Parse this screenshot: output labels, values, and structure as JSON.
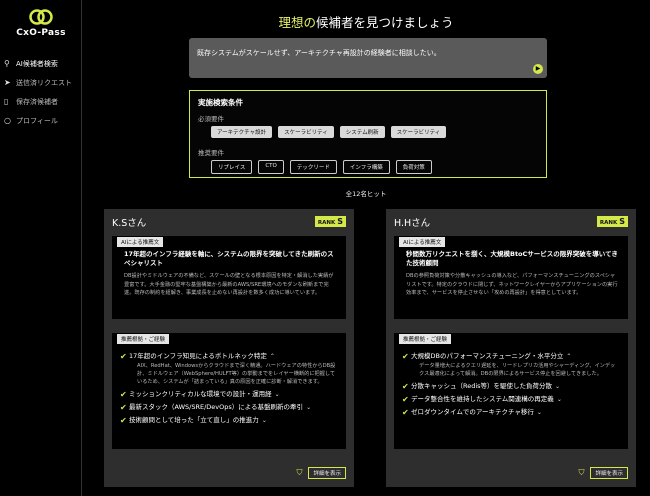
{
  "app": {
    "name": "CxO-Pass"
  },
  "sidebar": {
    "items": [
      {
        "label": "AI候補者検索",
        "icon": "search-person-icon",
        "active": true
      },
      {
        "label": "送信済リクエスト",
        "icon": "send-icon",
        "active": false
      },
      {
        "label": "保存済候補者",
        "icon": "bookmark-icon",
        "active": false
      },
      {
        "label": "プロフィール",
        "icon": "person-icon",
        "active": false
      }
    ]
  },
  "main": {
    "title_pre": "理想の",
    "title_post": "候補者を見つけましょう",
    "query": "既存システムがスケールせず、アーキテクチャ再設計の経験者に相談したい。",
    "conditions": {
      "title": "実施検索条件",
      "required_label": "必須要件",
      "required": [
        "アーキテクチャ設計",
        "スケーラビリティ",
        "システム刷新",
        "スケーラビリティ"
      ],
      "preferred_label": "推奨要件",
      "preferred": [
        "リプレイス",
        "CTO",
        "テックリード",
        "インフラ構築",
        "負荷対策"
      ]
    },
    "hits": "全12名ヒット"
  },
  "cards": [
    {
      "name": "K.Sさん",
      "rank_label": "RANK",
      "rank": "S",
      "ai_label": "AIによる推薦文",
      "ai_head": "17年超のインフラ経験を軸に、システムの限界を突破してきた刷新のスペシャリスト",
      "ai_body": "DB設計やミドルウェアの不備など、スケールの壁となる根本原因を特定・解消した実績が豊富です。大手金融の堅牢な基盤構築から最新のAWS/SRE環境へのモダンな刷新まで完遂。既存の制約を紐解き、事業成長を止めない再設計を数多く成功に導いています。",
      "rs_label": "推薦根拠・ご経験",
      "points": [
        {
          "text": "17年超のインフラ知見によるボトルネック特定",
          "detail": "AIX、RedHat、Windowsからクラウドまで深く精通。ハードウェアの特性からDB設計、ミドルウェア（WebSphere/HULFT等）の挙動までをレイヤー横断的に把握しているため、システムが「詰まっている」真の原因を正確に診断・解消できます。"
        },
        {
          "text": "ミッションクリティカルな環境での設計・運用経",
          "detail": ""
        },
        {
          "text": "最新スタック（AWS/SRE/DevOps）による基盤刷新の牽引",
          "detail": ""
        },
        {
          "text": "技術顧問として培った「立て直し」の推進力",
          "detail": ""
        }
      ],
      "detail_button": "詳細を表示"
    },
    {
      "name": "H.Hさん",
      "rank_label": "RANK",
      "rank": "S",
      "ai_label": "AIによる推薦文",
      "ai_head": "秒間数万リクエストを捌く、大規模BtoCサービスの限界突破を導いてきた技術顧問",
      "ai_body": "DBの参照負荷対策や分散キャッシュの導入など、パフォーマンスチューニングのスペシャリストです。特定のクラウドに閉じず、ネットワークレイヤーからアプリケーションの実行効率まで、サービスを停止させない「攻めの再設計」を得意としています。",
      "rs_label": "推薦根拠・ご経験",
      "points": [
        {
          "text": "大規模DBのパフォーマンスチューニング・水平分立",
          "detail": "データ量増大によるクエリ遅延を、リードレプリカ活用やシャーディング、インデックス最適化によって解消。DBの限界によるサービス停止を回避してきました。"
        },
        {
          "text": "分散キャッシュ（Redis等）を駆使した負荷分散",
          "detail": ""
        },
        {
          "text": "データ整合性を維持したシステム関連構の再定義",
          "detail": ""
        },
        {
          "text": "ゼロダウンタイムでのアーキテクチャ移行",
          "detail": ""
        }
      ],
      "detail_button": "詳細を表示"
    }
  ]
}
